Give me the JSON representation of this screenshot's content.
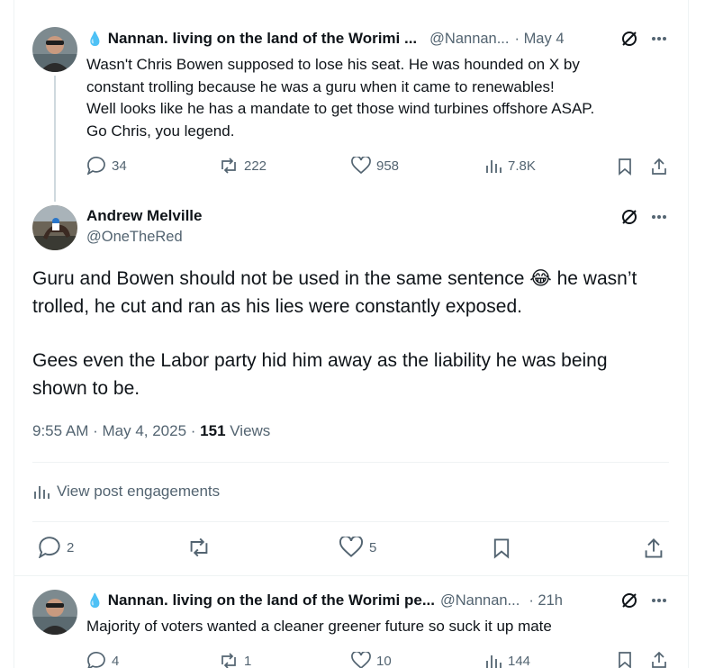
{
  "reply1": {
    "author_emoji": "💧",
    "author_name": "Nannan. living on the land of the Worimi ...",
    "handle": "@Nannan...",
    "date": "· May 4",
    "lines": [
      "Wasn't Chris Bowen supposed to lose his seat. He was hounded on X by",
      "constant trolling because he was a guru when it came to renewables!",
      "Well looks like he has a mandate to get those wind turbines offshore ASAP.",
      "Go Chris, you legend."
    ],
    "replies": "34",
    "reposts": "222",
    "likes": "958",
    "views": "7.8K"
  },
  "main": {
    "author_name": "Andrew Melville",
    "handle": "@OneTheRed",
    "para1_before_emoji": "Guru and Bowen should not be used in the same sentence ",
    "emoji": "😂",
    "para1_after_emoji": " he wasn’t",
    "para1_line2": "trolled, he cut and ran as his lies were constantly exposed.",
    "para2_line1": "Gees even the Labor party hid him away as the liability he was being",
    "para2_line2": "shown to be.",
    "time_date": "9:55 AM · May 4, 2025 · ",
    "views_count": "151",
    "views_label": " Views",
    "engagements_label": "View post engagements",
    "replies": "2",
    "reposts": "",
    "likes": "5"
  },
  "reply2": {
    "author_emoji": "💧",
    "author_name": "Nannan. living on the land of the Worimi pe...",
    "handle": "@Nannan...",
    "date": "· 21h",
    "text": "Majority of voters wanted a cleaner greener future so suck it up mate",
    "replies": "4",
    "reposts": "1",
    "likes": "10",
    "views": "144"
  },
  "colors": {
    "text": "#0f1419",
    "muted": "#536471",
    "border": "#eff3f4",
    "thread": "#cfd9de",
    "drop": "#1d9bf0"
  }
}
